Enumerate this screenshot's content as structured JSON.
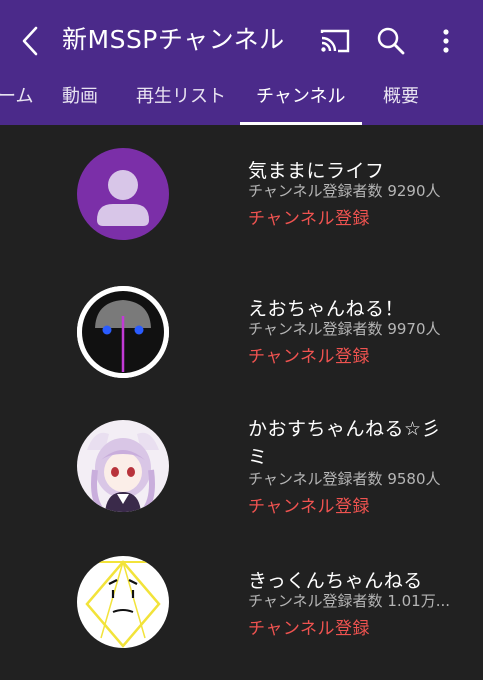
{
  "header": {
    "title": "新MSSPチャンネル"
  },
  "tabs": [
    {
      "label": "ーム"
    },
    {
      "label": "動画"
    },
    {
      "label": "再生リスト"
    },
    {
      "label": "チャンネル"
    },
    {
      "label": "概要"
    }
  ],
  "active_tab": "チャンネル",
  "channels": [
    {
      "name": "気ままにライフ",
      "subscribers": "チャンネル登録者数 9290人",
      "subscribe_label": "チャンネル登録"
    },
    {
      "name": "えおちゃんねる！",
      "subscribers": "チャンネル登録者数 9970人",
      "subscribe_label": "チャンネル登録"
    },
    {
      "name_line1": "かおすちゃんねる☆彡",
      "name_line2": "ミ",
      "subscribers": "チャンネル登録者数 9580人",
      "subscribe_label": "チャンネル登録"
    },
    {
      "name": "きっくんちゃんねる",
      "subscribers": "チャンネル登録者数 1.01万...",
      "subscribe_label": "チャンネル登録"
    }
  ],
  "icons": [
    "back-icon",
    "cast-icon",
    "search-icon",
    "more-icon"
  ],
  "colors": {
    "header_bg": "#4b2a8a",
    "background": "#212121",
    "subscribe": "#ef5350"
  }
}
